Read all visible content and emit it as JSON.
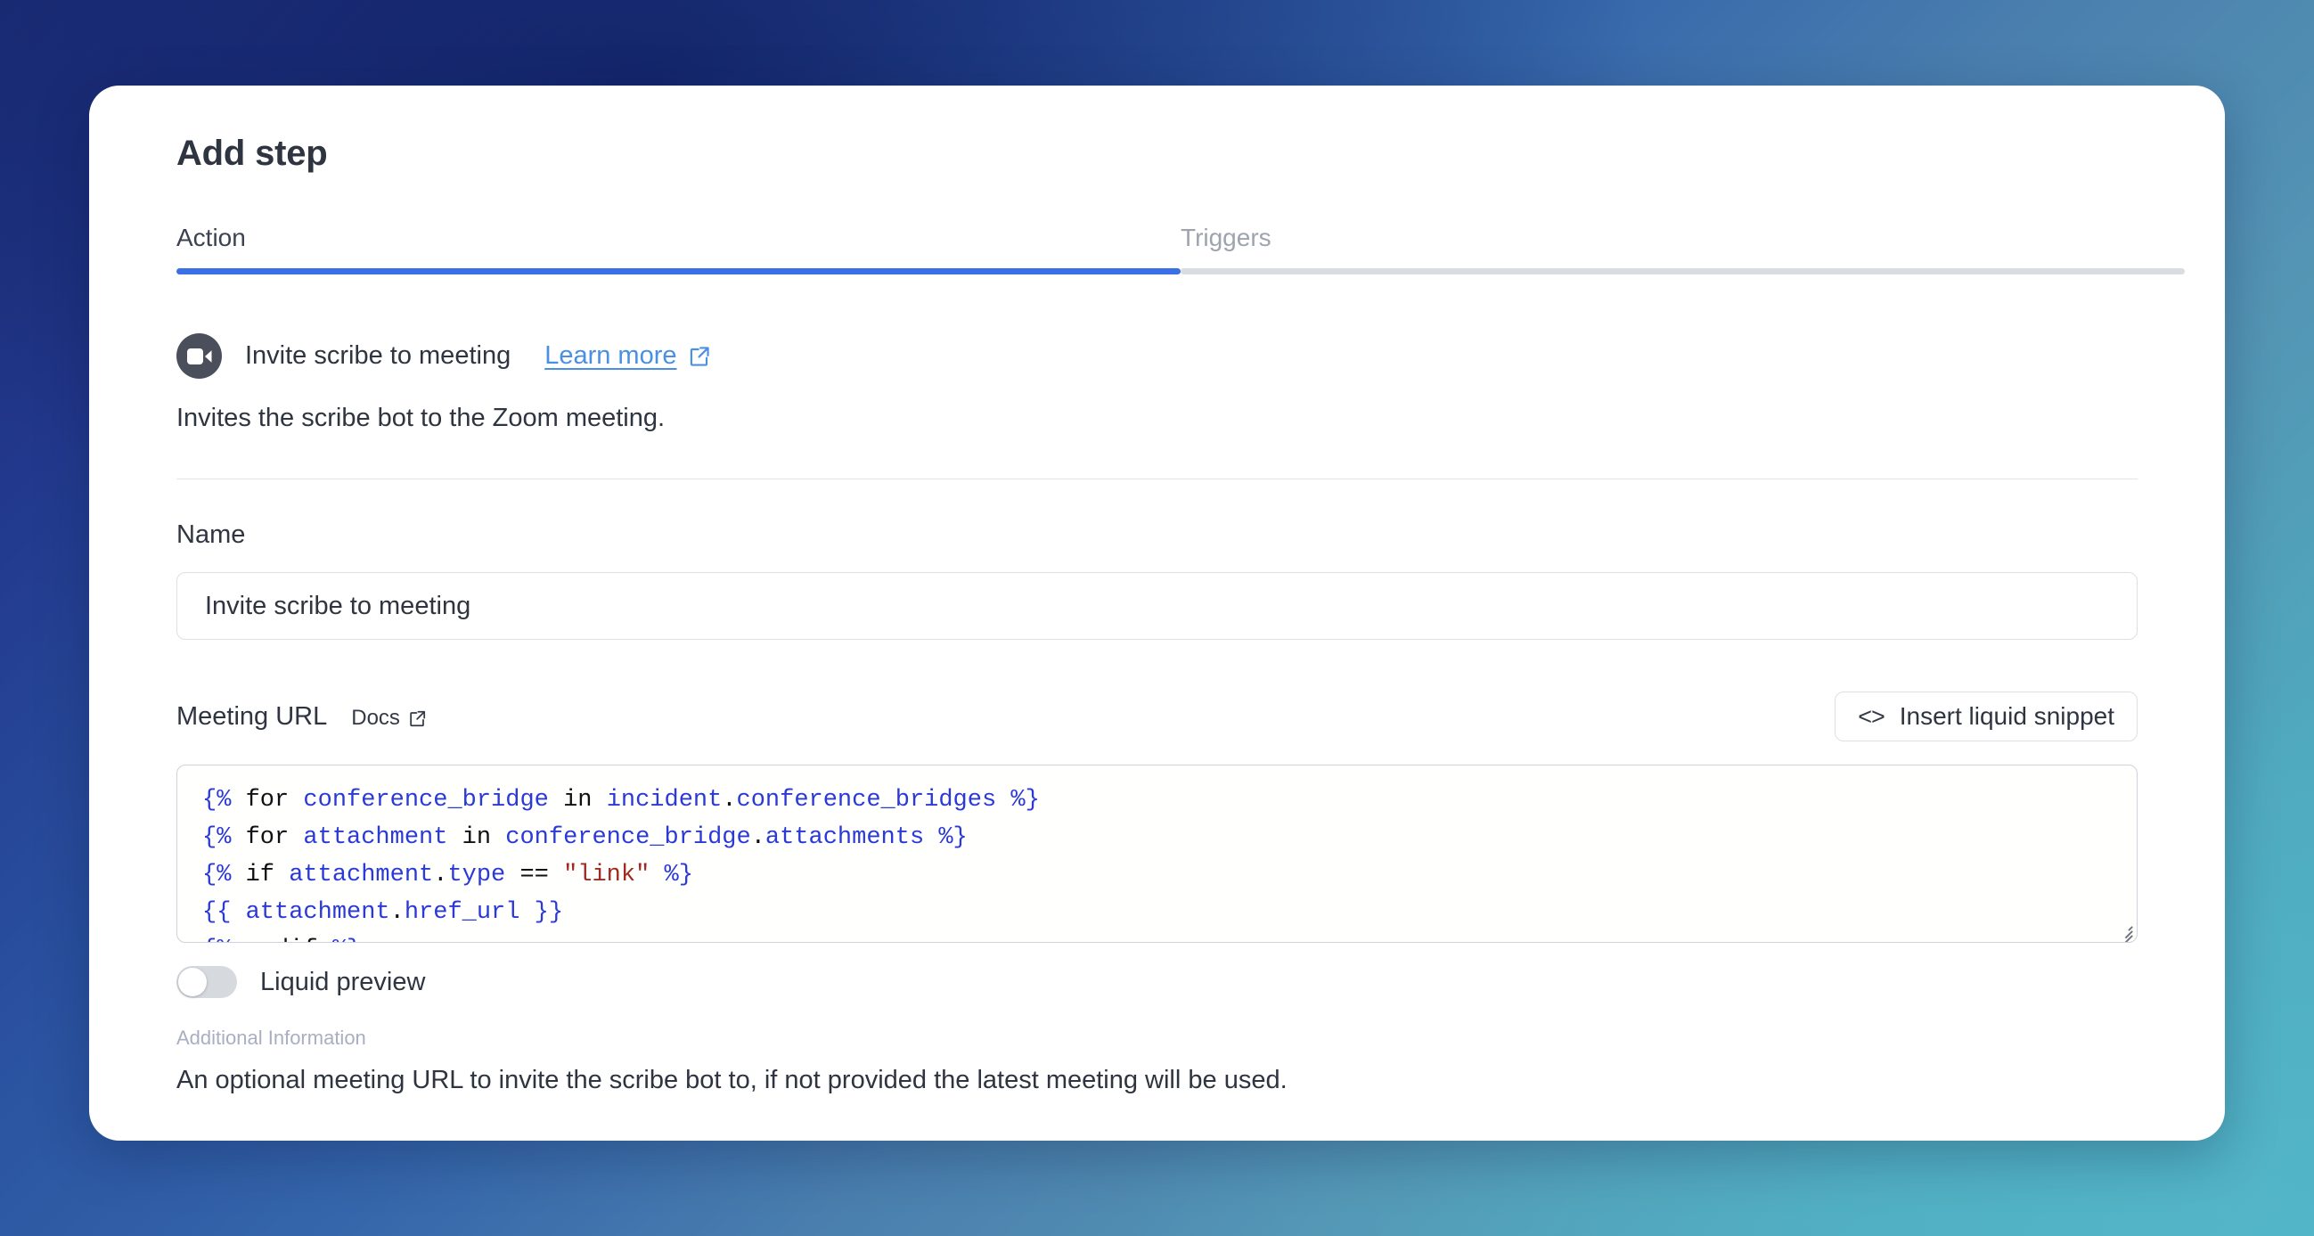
{
  "window": {
    "title": "Add step"
  },
  "tabs": [
    {
      "label": "Action",
      "active": true,
      "name": "tab-action"
    },
    {
      "label": "Triggers",
      "active": false,
      "name": "tab-triggers"
    }
  ],
  "action": {
    "icon": "zoom-video-camera-icon",
    "title": "Invite scribe to meeting",
    "learn_more_label": "Learn more",
    "learn_more_icon": "external-link-icon",
    "description": "Invites the scribe bot to the Zoom meeting."
  },
  "name_field": {
    "label": "Name",
    "value": "Invite scribe to meeting",
    "placeholder": "Invite scribe to meeting"
  },
  "meeting_url": {
    "label": "Meeting URL",
    "docs_label": "Docs",
    "docs_icon": "external-link-icon",
    "snippet_button_label": "Insert liquid snippet",
    "snippet_button_icon": "code-brackets-icon",
    "code_lines": [
      [
        {
          "t": "{%",
          "c": "delim"
        },
        {
          "t": " ",
          "c": "plain"
        },
        {
          "t": "for",
          "c": "kw"
        },
        {
          "t": " ",
          "c": "plain"
        },
        {
          "t": "conference_bridge",
          "c": "var"
        },
        {
          "t": " ",
          "c": "plain"
        },
        {
          "t": "in",
          "c": "kw"
        },
        {
          "t": " ",
          "c": "plain"
        },
        {
          "t": "incident",
          "c": "var"
        },
        {
          "t": ".",
          "c": "punct"
        },
        {
          "t": "conference_bridges",
          "c": "var"
        },
        {
          "t": " ",
          "c": "plain"
        },
        {
          "t": "%}",
          "c": "delim"
        }
      ],
      [
        {
          "t": "{%",
          "c": "delim"
        },
        {
          "t": " ",
          "c": "plain"
        },
        {
          "t": "for",
          "c": "kw"
        },
        {
          "t": " ",
          "c": "plain"
        },
        {
          "t": "attachment",
          "c": "var"
        },
        {
          "t": " ",
          "c": "plain"
        },
        {
          "t": "in",
          "c": "kw"
        },
        {
          "t": " ",
          "c": "plain"
        },
        {
          "t": "conference_bridge",
          "c": "var"
        },
        {
          "t": ".",
          "c": "punct"
        },
        {
          "t": "attachments",
          "c": "var"
        },
        {
          "t": " ",
          "c": "plain"
        },
        {
          "t": "%}",
          "c": "delim"
        }
      ],
      [
        {
          "t": "{%",
          "c": "delim"
        },
        {
          "t": " ",
          "c": "plain"
        },
        {
          "t": "if",
          "c": "kw"
        },
        {
          "t": " ",
          "c": "plain"
        },
        {
          "t": "attachment",
          "c": "var"
        },
        {
          "t": ".",
          "c": "punct"
        },
        {
          "t": "type",
          "c": "var"
        },
        {
          "t": " ",
          "c": "plain"
        },
        {
          "t": "==",
          "c": "punct"
        },
        {
          "t": " ",
          "c": "plain"
        },
        {
          "t": "\"link\"",
          "c": "str"
        },
        {
          "t": " ",
          "c": "plain"
        },
        {
          "t": "%}",
          "c": "delim"
        }
      ],
      [
        {
          "t": "{{",
          "c": "delim"
        },
        {
          "t": " ",
          "c": "plain"
        },
        {
          "t": "attachment",
          "c": "var"
        },
        {
          "t": ".",
          "c": "punct"
        },
        {
          "t": "href_url",
          "c": "var"
        },
        {
          "t": " ",
          "c": "plain"
        },
        {
          "t": "}}",
          "c": "delim"
        }
      ],
      [
        {
          "t": "{%",
          "c": "delim"
        },
        {
          "t": " ",
          "c": "plain"
        },
        {
          "t": "endif",
          "c": "kw"
        },
        {
          "t": " ",
          "c": "plain"
        },
        {
          "t": "%}",
          "c": "delim"
        }
      ]
    ]
  },
  "liquid_preview": {
    "label": "Liquid preview",
    "enabled": false
  },
  "additional_information": {
    "title": "Additional Information",
    "text": "An optional meeting URL to invite the scribe bot to, if not provided the latest meeting will be used."
  },
  "colors": {
    "accent_blue": "#3b6fe8",
    "link_blue": "#4a90e2",
    "icon_dark": "#4b4f5b",
    "text_primary": "#2e3440",
    "text_muted": "#9ea4ae",
    "helper_label": "#a9aec2",
    "code_delim": "#2b3ad6",
    "code_string": "#9e2a21",
    "border": "#dcdfe4"
  }
}
